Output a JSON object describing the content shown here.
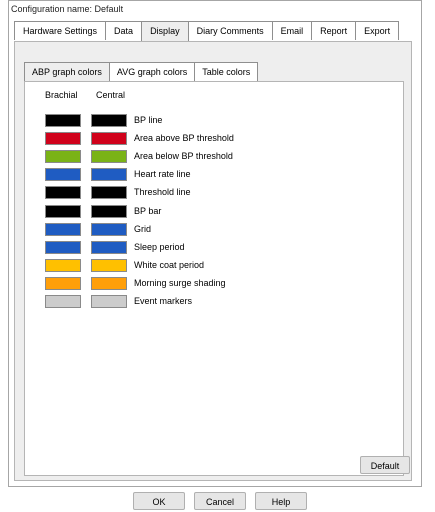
{
  "window": {
    "title": "Configuration name: Default"
  },
  "tabs": [
    "Hardware Settings",
    "Data",
    "Display",
    "Diary Comments",
    "Email",
    "Report",
    "Export"
  ],
  "active_tab": "Display",
  "subtabs": [
    "ABP graph colors",
    "AVG graph colors",
    "Table colors"
  ],
  "active_subtab": "ABP graph colors",
  "columns": {
    "brachial": "Brachial",
    "central": "Central"
  },
  "rows": [
    {
      "label": "BP line",
      "brachial": "#000000",
      "central": "#000000"
    },
    {
      "label": "Area above BP threshold",
      "brachial": "#d0021b",
      "central": "#d0021b"
    },
    {
      "label": "Area below BP threshold",
      "brachial": "#7ab317",
      "central": "#7ab317"
    },
    {
      "label": "Heart rate line",
      "brachial": "#1f5cc2",
      "central": "#1f5cc2"
    },
    {
      "label": "Threshold line",
      "brachial": "#000000",
      "central": "#000000"
    },
    {
      "label": "BP bar",
      "brachial": "#000000",
      "central": "#000000"
    },
    {
      "label": "Grid",
      "brachial": "#1f5cc2",
      "central": "#1f5cc2"
    },
    {
      "label": "Sleep period",
      "brachial": "#1f5cc2",
      "central": "#1f5cc2"
    },
    {
      "label": "White coat period",
      "brachial": "#ffc000",
      "central": "#ffc000"
    },
    {
      "label": "Morning surge shading",
      "brachial": "#ff9f0a",
      "central": "#ff9f0a"
    },
    {
      "label": "Event markers",
      "brachial": "#cccccc",
      "central": "#cccccc"
    }
  ],
  "buttons": {
    "default": "Default",
    "ok": "OK",
    "cancel": "Cancel",
    "help": "Help"
  }
}
